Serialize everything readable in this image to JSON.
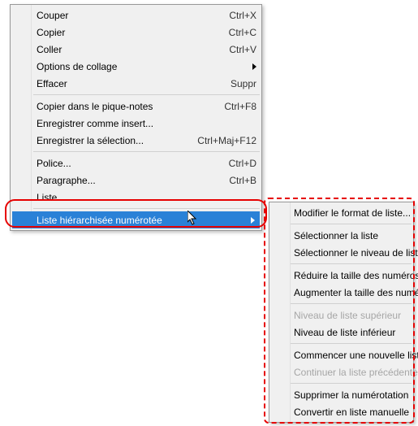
{
  "main_menu": {
    "items": [
      {
        "label": "Couper",
        "shortcut": "Ctrl+X"
      },
      {
        "label": "Copier",
        "shortcut": "Ctrl+C"
      },
      {
        "label": "Coller",
        "shortcut": "Ctrl+V"
      },
      {
        "label": "Options de collage",
        "shortcut": "",
        "submenu": true
      },
      {
        "label": "Effacer",
        "shortcut": "Suppr"
      },
      {
        "sep": true
      },
      {
        "label": "Copier dans le pique-notes",
        "shortcut": "Ctrl+F8"
      },
      {
        "label": "Enregistrer comme insert...",
        "shortcut": ""
      },
      {
        "label": "Enregistrer la sélection...",
        "shortcut": "Ctrl+Maj+F12"
      },
      {
        "sep": true
      },
      {
        "label": "Police...",
        "shortcut": "Ctrl+D"
      },
      {
        "label": "Paragraphe...",
        "shortcut": "Ctrl+B"
      },
      {
        "label": "Liste...",
        "shortcut": ""
      },
      {
        "sep": true
      },
      {
        "label": "Liste hiérarchisée numérotée",
        "shortcut": "",
        "submenu": true,
        "highlighted": true
      }
    ]
  },
  "sub_menu": {
    "items": [
      {
        "label": "Modifier le format de liste..."
      },
      {
        "sep": true
      },
      {
        "label": "Sélectionner la liste"
      },
      {
        "label": "Sélectionner le niveau de liste"
      },
      {
        "sep": true
      },
      {
        "label": "Réduire la taille des numéros"
      },
      {
        "label": "Augmenter la taille des numéros"
      },
      {
        "sep": true
      },
      {
        "label": "Niveau de liste supérieur",
        "disabled": true
      },
      {
        "label": "Niveau de liste inférieur"
      },
      {
        "sep": true
      },
      {
        "label": "Commencer une nouvelle liste"
      },
      {
        "label": "Continuer la liste précédente",
        "disabled": true
      },
      {
        "sep": true
      },
      {
        "label": "Supprimer la numérotation"
      },
      {
        "label": "Convertir en liste manuelle"
      }
    ]
  }
}
